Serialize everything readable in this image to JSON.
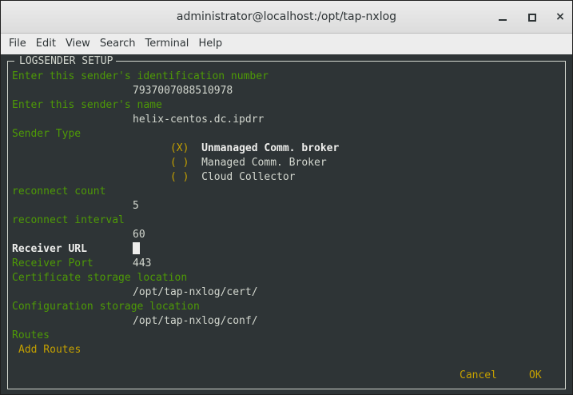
{
  "window": {
    "title": "administrator@localhost:/opt/tap-nxlog",
    "minimize_icon": "minimize-icon",
    "maximize_icon": "maximize-icon",
    "close_icon": "close-icon",
    "close_glyph": "×"
  },
  "menu": [
    "File",
    "Edit",
    "View",
    "Search",
    "Terminal",
    "Help"
  ],
  "form": {
    "frame_title": "LOGSENDER SETUP",
    "sender_id_label": "Enter this sender's identification number",
    "sender_id_value": "7937007088510978",
    "sender_name_label": "Enter this sender's name",
    "sender_name_value": "helix-centos.dc.ipdrr",
    "sender_type_label": "Sender Type",
    "sender_type_options": [
      {
        "mark": "(X)",
        "label": "Unmanaged Comm. broker"
      },
      {
        "mark": "( )",
        "label": "Managed Comm. Broker"
      },
      {
        "mark": "( )",
        "label": "Cloud Collector"
      }
    ],
    "reconnect_count_label": "reconnect count",
    "reconnect_count_value": "5",
    "reconnect_interval_label": "reconnect interval",
    "reconnect_interval_value": "60",
    "receiver_url_label": "Receiver URL",
    "receiver_url_value": "",
    "receiver_port_label": "Receiver Port",
    "receiver_port_value": "443",
    "cert_location_label": "Certificate storage location",
    "cert_location_value": "/opt/tap-nxlog/cert/",
    "config_location_label": "Configuration storage location",
    "config_location_value": "/opt/tap-nxlog/conf/",
    "routes_label": "Routes",
    "add_routes_label": "Add Routes",
    "cancel_label": "Cancel",
    "ok_label": "OK"
  },
  "colors": {
    "label_green": "#4e9a06",
    "value_white": "#d3d7cf",
    "accent_yellow": "#c4a000",
    "terminal_bg": "#2e3436"
  }
}
